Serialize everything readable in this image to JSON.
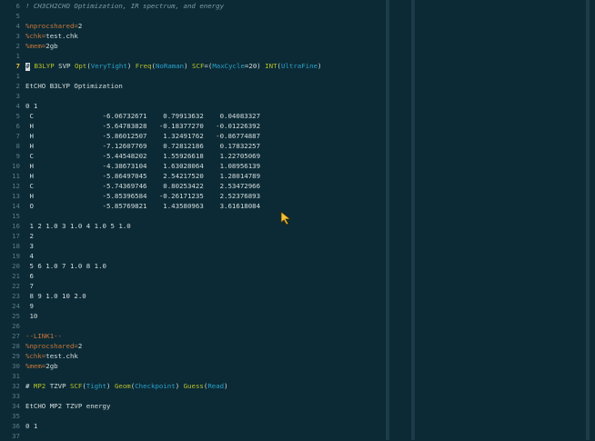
{
  "lines": [
    {
      "n": "6",
      "segs": [
        [
          "cm",
          "! CH3CH2CHO Optimization, IR spectrum, and energy"
        ]
      ]
    },
    {
      "n": "5",
      "segs": []
    },
    {
      "n": "4",
      "segs": [
        [
          "dir",
          "%nprocshared="
        ],
        [
          "plain",
          "2"
        ]
      ]
    },
    {
      "n": "3",
      "segs": [
        [
          "dir",
          "%chk="
        ],
        [
          "plain",
          "test.chk"
        ]
      ]
    },
    {
      "n": "2",
      "segs": [
        [
          "dir",
          "%mem="
        ],
        [
          "plain",
          "2gb"
        ]
      ]
    },
    {
      "n": "1",
      "segs": []
    },
    {
      "n": "7",
      "current": true,
      "cursor": "#",
      "segs": [
        [
          "plain",
          " "
        ],
        [
          "kw",
          "B3LYP"
        ],
        [
          "plain",
          " SVP "
        ],
        [
          "kw",
          "Opt"
        ],
        [
          "plain",
          "("
        ],
        [
          "arg",
          "VeryTight"
        ],
        [
          "plain",
          ") "
        ],
        [
          "kw",
          "Freq"
        ],
        [
          "plain",
          "("
        ],
        [
          "arg",
          "NoRaman"
        ],
        [
          "plain",
          ") "
        ],
        [
          "kw",
          "SCF"
        ],
        [
          "plain",
          "=("
        ],
        [
          "arg",
          "MaxCycle"
        ],
        [
          "plain",
          "=20) "
        ],
        [
          "kw",
          "INT"
        ],
        [
          "plain",
          "("
        ],
        [
          "arg",
          "UltraFine"
        ],
        [
          "plain",
          ")"
        ]
      ]
    },
    {
      "n": "1",
      "segs": []
    },
    {
      "n": "2",
      "segs": [
        [
          "plain",
          "EtCHO B3LYP Optimization"
        ]
      ]
    },
    {
      "n": "3",
      "segs": []
    },
    {
      "n": "4",
      "segs": [
        [
          "plain",
          "0 1"
        ]
      ]
    },
    {
      "n": "5",
      "segs": [
        [
          "plain",
          " C                 -6.06732671    0.79913632    0.04083327"
        ]
      ]
    },
    {
      "n": "6",
      "segs": [
        [
          "plain",
          " H                 -5.64783828   -0.18377270   -0.01226392"
        ]
      ]
    },
    {
      "n": "7",
      "segs": [
        [
          "plain",
          " H                 -5.86012507    1.32491762   -0.86774887"
        ]
      ]
    },
    {
      "n": "8",
      "segs": [
        [
          "plain",
          " H                 -7.12607769    0.72812186    0.17832257"
        ]
      ]
    },
    {
      "n": "9",
      "segs": [
        [
          "plain",
          " C                 -5.44548202    1.55926618    1.22705069"
        ]
      ]
    },
    {
      "n": "10",
      "segs": [
        [
          "plain",
          " H                 -4.38673104    1.63028064    1.08956139"
        ]
      ]
    },
    {
      "n": "11",
      "segs": [
        [
          "plain",
          " H                 -5.86497045    2.54217520    1.28014789"
        ]
      ]
    },
    {
      "n": "12",
      "segs": [
        [
          "plain",
          " C                 -5.74369746    0.80253422    2.53472966"
        ]
      ]
    },
    {
      "n": "13",
      "segs": [
        [
          "plain",
          " H                 -5.85396584   -0.26171235    2.52376893"
        ]
      ]
    },
    {
      "n": "14",
      "segs": [
        [
          "plain",
          " O                 -5.85769821    1.43580963    3.61618084"
        ]
      ]
    },
    {
      "n": "15",
      "segs": []
    },
    {
      "n": "16",
      "segs": [
        [
          "plain",
          " 1 2 1.0 3 1.0 4 1.0 5 1.0"
        ]
      ]
    },
    {
      "n": "17",
      "segs": [
        [
          "plain",
          " 2"
        ]
      ]
    },
    {
      "n": "18",
      "segs": [
        [
          "plain",
          " 3"
        ]
      ]
    },
    {
      "n": "19",
      "segs": [
        [
          "plain",
          " 4"
        ]
      ]
    },
    {
      "n": "20",
      "segs": [
        [
          "plain",
          " 5 6 1.0 7 1.0 8 1.0"
        ]
      ]
    },
    {
      "n": "21",
      "segs": [
        [
          "plain",
          " 6"
        ]
      ]
    },
    {
      "n": "22",
      "segs": [
        [
          "plain",
          " 7"
        ]
      ]
    },
    {
      "n": "23",
      "segs": [
        [
          "plain",
          " 8 9 1.0 10 2.0"
        ]
      ]
    },
    {
      "n": "24",
      "segs": [
        [
          "plain",
          " 9"
        ]
      ]
    },
    {
      "n": "25",
      "segs": [
        [
          "plain",
          " 10"
        ]
      ]
    },
    {
      "n": "26",
      "segs": []
    },
    {
      "n": "27",
      "segs": [
        [
          "dir",
          "--LINK1--"
        ]
      ]
    },
    {
      "n": "28",
      "segs": [
        [
          "dir",
          "%nprocshared="
        ],
        [
          "plain",
          "2"
        ]
      ]
    },
    {
      "n": "29",
      "segs": [
        [
          "dir",
          "%chk="
        ],
        [
          "plain",
          "test.chk"
        ]
      ]
    },
    {
      "n": "30",
      "segs": [
        [
          "dir",
          "%mem="
        ],
        [
          "plain",
          "2gb"
        ]
      ]
    },
    {
      "n": "31",
      "segs": []
    },
    {
      "n": "32",
      "segs": [
        [
          "plain",
          "# "
        ],
        [
          "kw",
          "MP2"
        ],
        [
          "plain",
          " TZVP "
        ],
        [
          "kw",
          "SCF"
        ],
        [
          "plain",
          "("
        ],
        [
          "arg",
          "Tight"
        ],
        [
          "plain",
          ") "
        ],
        [
          "kw",
          "Geom"
        ],
        [
          "plain",
          "("
        ],
        [
          "arg",
          "Checkpoint"
        ],
        [
          "plain",
          ") "
        ],
        [
          "kw",
          "Guess"
        ],
        [
          "plain",
          "("
        ],
        [
          "arg",
          "Read"
        ],
        [
          "plain",
          ")"
        ]
      ]
    },
    {
      "n": "33",
      "segs": []
    },
    {
      "n": "34",
      "segs": [
        [
          "plain",
          "EtCHO MP2 TZVP energy"
        ]
      ]
    },
    {
      "n": "35",
      "segs": []
    },
    {
      "n": "36",
      "segs": [
        [
          "plain",
          "0 1"
        ]
      ]
    },
    {
      "n": "37",
      "segs": []
    }
  ],
  "colors": {
    "background": "#0b2a35",
    "comment": "#7a9aa3",
    "directive": "#c8763a",
    "keyword": "#b8bf2a",
    "argument": "#2aa1c9",
    "current_line_number": "#f2c13a"
  },
  "pointer_icon": "mouse-pointer-icon"
}
